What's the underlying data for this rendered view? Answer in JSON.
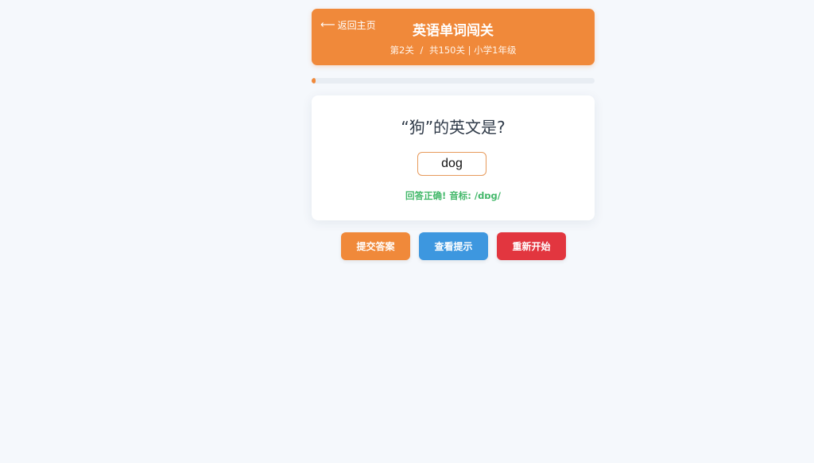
{
  "header": {
    "back_icon": "left-arrow-icon",
    "back_label": "返回主页",
    "title": "英语单词闯关",
    "level": "第2关",
    "separator": "/",
    "total": "共150关",
    "grade": "| 小学1年级"
  },
  "progress": {
    "value": 0.0133,
    "color": "#f0893a"
  },
  "quiz": {
    "question": "“狗”的英文是?",
    "answer_value": "dog",
    "feedback": "回答正确! 音标: /dɒg/"
  },
  "actions": {
    "submit": "提交答案",
    "hint": "查看提示",
    "restart": "重新开始"
  },
  "colors": {
    "accent": "#f0893a",
    "hint": "#3d97df",
    "danger": "#e2363f",
    "success": "#43b86a",
    "background": "#f5f8fc"
  }
}
